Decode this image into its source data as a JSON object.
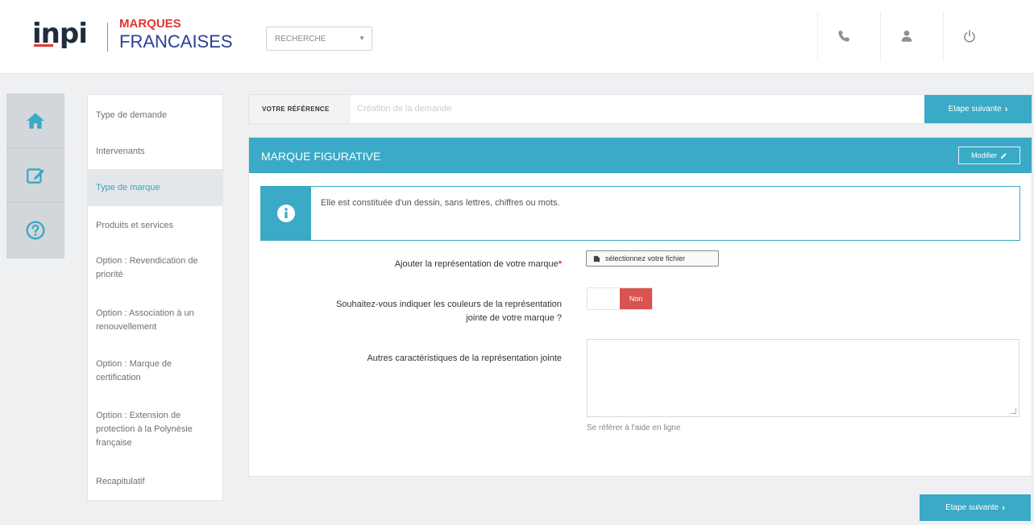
{
  "header": {
    "logo_inpi": "inpi",
    "logo_line1": "MARQUES",
    "logo_line2": "FRANCAISES",
    "search_select": "RECHERCHE"
  },
  "steps": [
    "Type de demande",
    "Intervenants",
    "Type de marque",
    "Produits et services",
    "Option : Revendication de priorité",
    "Option : Association à un renouvellement",
    "Option : Marque de certification",
    "Option : Extension de protection à la Polynésie française",
    "Recapitulatif"
  ],
  "active_step": "Type de marque",
  "refbar": {
    "label": "VOTRE RÉFÉRENCE",
    "placeholder": "Création de la demande"
  },
  "next_button": "Etape suivante",
  "panel": {
    "title": "MARQUE FIGURATIVE",
    "modify": "Modifier",
    "info": "Elle est constituée d'un dessin, sans lettres, chiffres ou mots."
  },
  "form": {
    "rep_label": "Ajouter la représentation de votre marque",
    "file_button": "sélectionnez votre fichier",
    "colors_label_1": "Souhaitez-vous indiquer les couleurs de la représentation",
    "colors_label_2": "jointe de votre marque ?",
    "toggle_value": "Non",
    "other_label": "Autres caractéristiques de la représentation jointe",
    "help": "Se référer à l'aide en ligne"
  },
  "colors": {
    "accent": "#3aaac6",
    "danger": "#d9534f",
    "brand_red": "#e3342f",
    "brand_blue": "#2b3f96"
  }
}
